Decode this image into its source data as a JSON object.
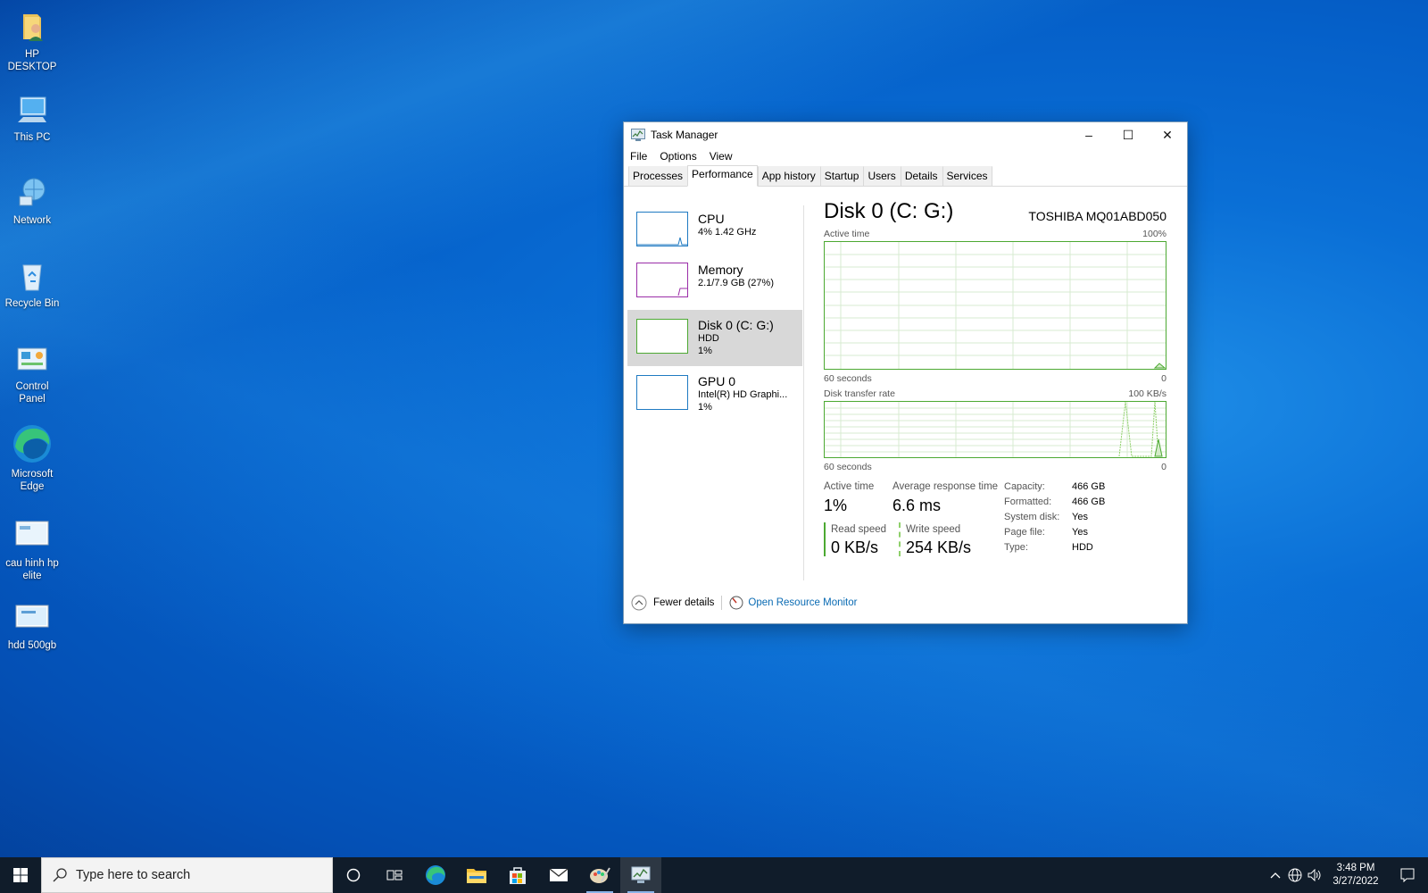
{
  "desktop": {
    "icons": [
      {
        "label": "HP DESKTOP",
        "icon": "user-folder-icon"
      },
      {
        "label": "This PC",
        "icon": "this-pc-icon"
      },
      {
        "label": "Network",
        "icon": "network-icon"
      },
      {
        "label": "Recycle Bin",
        "icon": "recycle-bin-icon"
      },
      {
        "label": "Control Panel",
        "icon": "control-panel-icon"
      },
      {
        "label": "Microsoft Edge",
        "icon": "edge-icon"
      },
      {
        "label": "cau hinh hp elite",
        "icon": "image-file-icon"
      },
      {
        "label": "hdd 500gb",
        "icon": "image-file-icon"
      }
    ]
  },
  "task_manager": {
    "title": "Task Manager",
    "controls": {
      "minimize": "–",
      "maximize": "☐",
      "close": "✕"
    },
    "menu": [
      "File",
      "Options",
      "View"
    ],
    "tabs": [
      "Processes",
      "Performance",
      "App history",
      "Startup",
      "Users",
      "Details",
      "Services"
    ],
    "active_tab": "Performance",
    "sidebar": [
      {
        "name": "CPU",
        "line1": "4%  1.42 GHz",
        "line2": "",
        "color": "#1f7ac2"
      },
      {
        "name": "Memory",
        "line1": "2.1/7.9 GB (27%)",
        "line2": "",
        "color": "#9b2ea8"
      },
      {
        "name": "Disk 0 (C: G:)",
        "line1": "HDD",
        "line2": "1%",
        "color": "#4ca932"
      },
      {
        "name": "GPU 0",
        "line1": "Intel(R) HD Graphi...",
        "line2": "1%",
        "color": "#1f7ac2"
      }
    ],
    "selected": "Disk 0 (C: G:)",
    "main": {
      "title": "Disk 0 (C: G:)",
      "model": "TOSHIBA MQ01ABD050",
      "graph1": {
        "label": "Active time",
        "max": "100%",
        "left": "60 seconds",
        "right": "0"
      },
      "graph2": {
        "label": "Disk transfer rate",
        "max": "100 KB/s",
        "left": "60 seconds",
        "right": "0"
      },
      "stats": {
        "active_time_label": "Active time",
        "active_time_value": "1%",
        "avg_resp_label": "Average response time",
        "avg_resp_value": "6.6 ms",
        "read_label": "Read speed",
        "read_value": "0 KB/s",
        "write_label": "Write speed",
        "write_value": "254 KB/s"
      },
      "properties": [
        {
          "label": "Capacity:",
          "value": "466 GB"
        },
        {
          "label": "Formatted:",
          "value": "466 GB"
        },
        {
          "label": "System disk:",
          "value": "Yes"
        },
        {
          "label": "Page file:",
          "value": "Yes"
        },
        {
          "label": "Type:",
          "value": "HDD"
        }
      ]
    },
    "footer": {
      "fewer_details": "Fewer details",
      "resource_monitor": "Open Resource Monitor"
    }
  },
  "taskbar": {
    "search_placeholder": "Type here to search",
    "clock_time": "3:48 PM",
    "clock_date": "3/27/2022"
  }
}
